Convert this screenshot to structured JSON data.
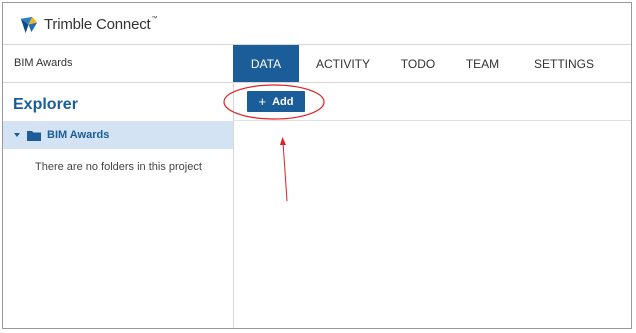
{
  "app": {
    "brand": "Trimble Connect",
    "trademark": "™",
    "accent": "#1a5d99"
  },
  "project": {
    "name": "BIM Awards"
  },
  "tabs": [
    {
      "label": "DATA",
      "active": true
    },
    {
      "label": "ACTIVITY"
    },
    {
      "label": "TODO"
    },
    {
      "label": "TEAM"
    },
    {
      "label": "SETTINGS"
    }
  ],
  "sidebar": {
    "title": "Explorer",
    "tree": [
      {
        "label": "BIM Awards",
        "icon": "folder-icon",
        "expanded": true
      }
    ],
    "empty_message": "There are no folders in this project"
  },
  "toolbar": {
    "add_label": "Add",
    "add_icon": "plus-icon"
  },
  "annotation": {
    "color": "#e02020"
  }
}
